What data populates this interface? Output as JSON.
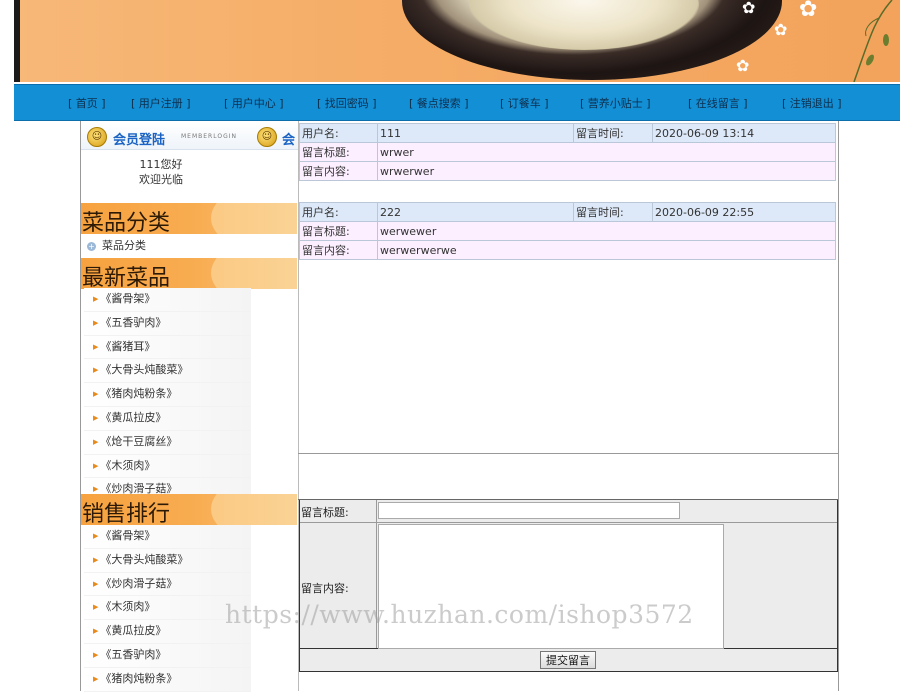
{
  "nav": {
    "items": [
      "[ 首页 ]",
      "[ 用户注册 ]",
      "[ 用户中心 ]",
      "[ 找回密码 ]",
      "[ 餐点搜索 ]",
      "[ 订餐车 ]",
      "[ 营养小贴士 ]",
      "[ 在线留言 ]",
      "[ 注销退出 ]"
    ]
  },
  "member": {
    "title": "会员登陆",
    "subtitle": "MEMBERLOGIN",
    "title_repeat": "会",
    "greeting": "111您好",
    "welcome": "欢迎光临"
  },
  "category": {
    "title": "菜品分类",
    "item": "菜品分类"
  },
  "latest": {
    "title": "最新菜品",
    "items": [
      "《酱骨架》",
      "《五香驴肉》",
      "《酱猪耳》",
      "《大骨头炖酸菜》",
      "《猪肉炖粉条》",
      "《黄瓜拉皮》",
      "《炝干豆腐丝》",
      "《木须肉》",
      "《炒肉滑子菇》"
    ]
  },
  "ranking": {
    "title": "销售排行",
    "items": [
      "《酱骨架》",
      "《大骨头炖酸菜》",
      "《炒肉滑子菇》",
      "《木须肉》",
      "《黄瓜拉皮》",
      "《五香驴肉》",
      "《猪肉炖粉条》"
    ]
  },
  "messages": [
    {
      "user_label": "用户名:",
      "user": "111",
      "time_label": "留言时间:",
      "time": "2020-06-09 13:14",
      "title_label": "留言标题:",
      "title": "wrwer",
      "content_label": "留言内容:",
      "content": "wrwerwer"
    },
    {
      "user_label": "用户名:",
      "user": "222",
      "time_label": "留言时间:",
      "time": "2020-06-09 22:55",
      "title_label": "留言标题:",
      "title": "werwewer",
      "content_label": "留言内容:",
      "content": "werwerwerwe"
    }
  ],
  "form": {
    "title_label": "留言标题:",
    "title_value": "",
    "content_label": "留言内容:",
    "content_value": "",
    "submit": "提交留言"
  },
  "watermark": "https://www.huzhan.com/ishop3572",
  "colors": {
    "nav_bg": "#138fd6",
    "section_orange": "#f7a23f",
    "row_blue": "#dde9f8",
    "row_pink": "#fcefff"
  }
}
